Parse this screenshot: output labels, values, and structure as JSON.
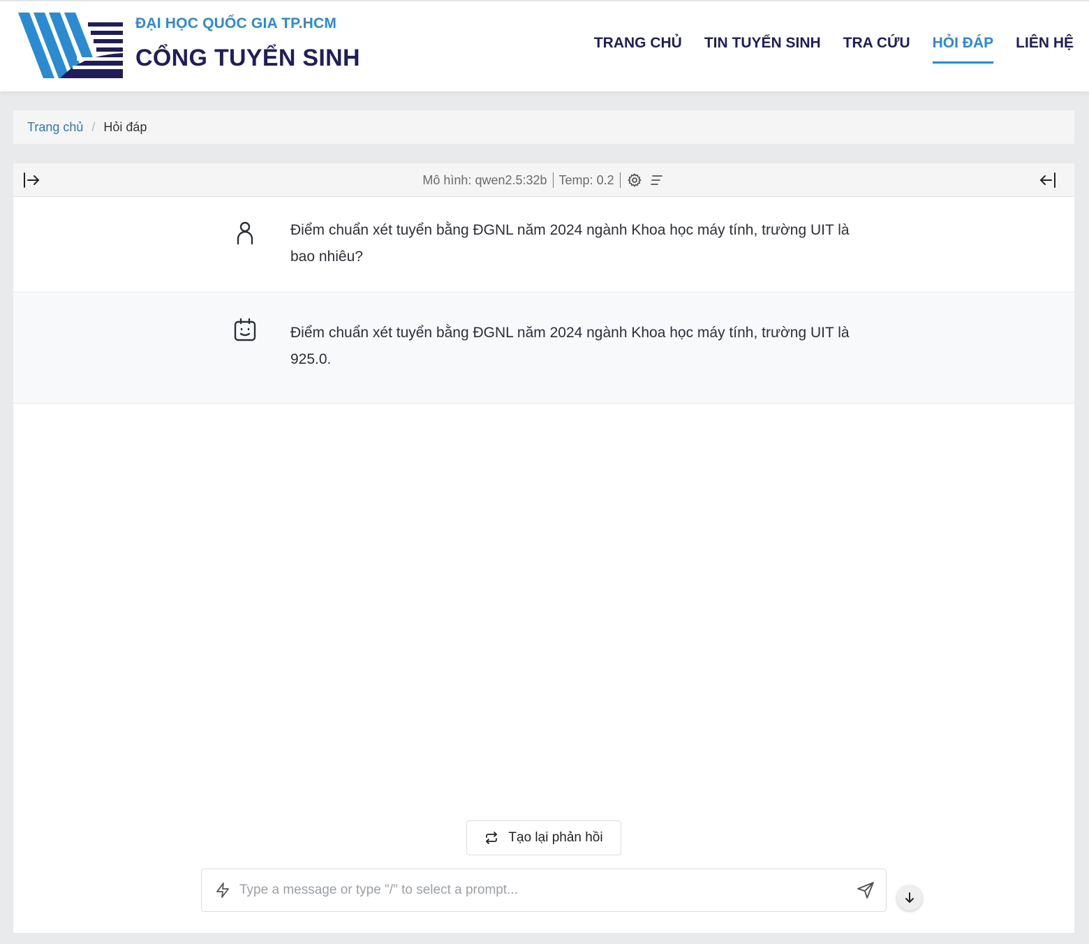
{
  "header": {
    "brand_top": "ĐẠI HỌC QUỐC GIA TP.HCM",
    "brand_main": "CỔNG TUYỂN SINH",
    "nav": [
      {
        "label": "TRANG CHỦ",
        "active": false
      },
      {
        "label": "TIN TUYỂN SINH",
        "active": false
      },
      {
        "label": "TRA CỨU",
        "active": false
      },
      {
        "label": "HỎI ĐÁP",
        "active": true
      },
      {
        "label": "LIÊN HỆ",
        "active": false
      }
    ]
  },
  "breadcrumb": {
    "home": "Trang chủ",
    "separator": "/",
    "current": "Hỏi đáp"
  },
  "toolbar": {
    "model": "Mô hình: qwen2.5:32b",
    "temp": "Temp: 0.2",
    "icons": [
      "expand-sidebar-icon",
      "gear-icon",
      "text-align-icon",
      "collapse-panel-icon"
    ]
  },
  "messages": [
    {
      "role": "user",
      "icon": "user-icon",
      "text": "Điểm chuẩn xét tuyển bằng ĐGNL năm 2024 ngành Khoa học máy tính, trường UIT là bao nhiêu?"
    },
    {
      "role": "assistant",
      "icon": "bot-icon",
      "text": "Điểm chuẩn xét tuyển bằng ĐGNL năm 2024 ngành Khoa học máy tính, trường UIT là 925.0."
    }
  ],
  "regenerate_label": "Tạo lại phản hồi",
  "input": {
    "value": "",
    "placeholder": "Type a message or type \"/\" to select a prompt..."
  },
  "colors": {
    "brand_navy": "#1f1e5a",
    "brand_blue": "#2a8bd0",
    "link_blue": "#2a7bbf"
  }
}
